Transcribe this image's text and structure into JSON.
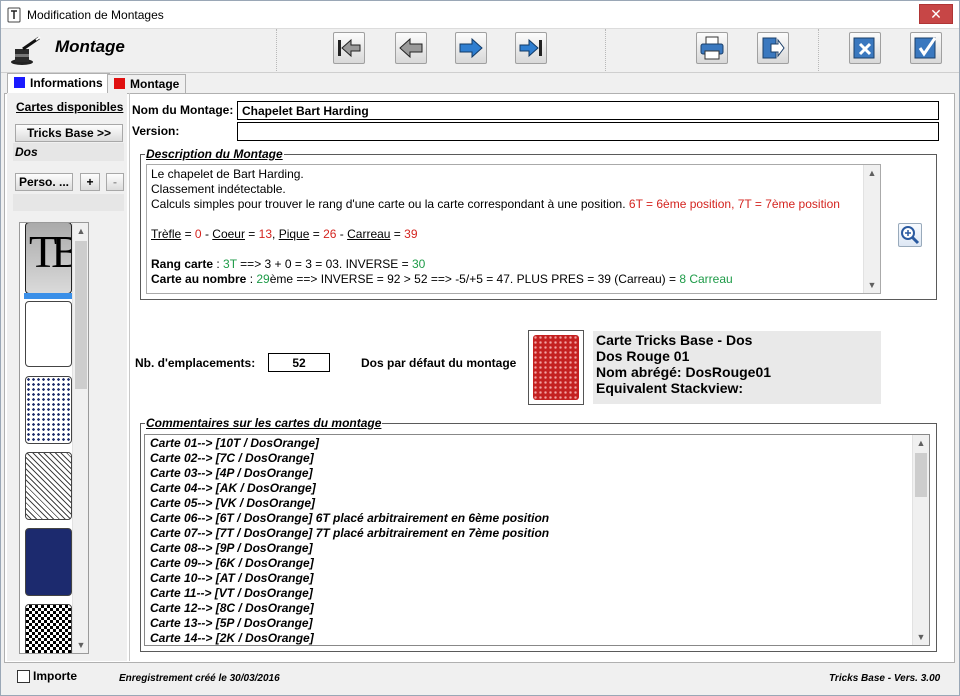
{
  "window": {
    "title": "Modification de Montages",
    "close_glyph": "✕"
  },
  "toolbar": {
    "heading": "Montage",
    "buttons": [
      {
        "name": "first-record-button",
        "icon": "first-arrow-icon"
      },
      {
        "name": "previous-record-button",
        "icon": "left-arrow-icon"
      },
      {
        "name": "next-record-button",
        "icon": "right-arrow-icon"
      },
      {
        "name": "last-record-button",
        "icon": "last-arrow-icon"
      },
      {
        "name": "print-button",
        "icon": "printer-icon"
      },
      {
        "name": "export-button",
        "icon": "exit-arrow-icon"
      },
      {
        "name": "cancel-button",
        "icon": "cancel-x-icon"
      },
      {
        "name": "validate-button",
        "icon": "checkmark-icon"
      }
    ]
  },
  "tabs": [
    {
      "label": "Informations",
      "color": "#1a1aff",
      "active": true
    },
    {
      "label": "Montage",
      "color": "#e01010",
      "active": false
    }
  ],
  "sidebar": {
    "cards_label": "Cartes disponibles",
    "tricks_button": "Tricks Base >>",
    "dos_label": "Dos",
    "perso_button": "Perso. ...",
    "plus_button": "+",
    "minus_button": "-",
    "thumb_logo": "TB"
  },
  "form": {
    "name_label": "Nom du Montage:",
    "name_value": "Chapelet Bart Harding",
    "version_label": "Version:",
    "version_value": ""
  },
  "description": {
    "title": "Description du Montage",
    "line1": "Le chapelet de Bart Harding.",
    "line2": "Classement indétectable.",
    "line3_text": "Calculs simples pour trouver le rang d'une carte ou la carte correspondant à une position. ",
    "line3_red": "6T = 6ème position, 7T = 7ème position",
    "suits": {
      "trefle": "Trèfle",
      "trefle_eq": " = ",
      "trefle_val": "0",
      "sep1": " - ",
      "coeur": "Coeur",
      "coeur_eq": " = ",
      "coeur_val": "13",
      "sep2": ", ",
      "pique": "Pique",
      "pique_eq": " = ",
      "pique_val": "26",
      "sep3": " - ",
      "carreau": "Carreau",
      "carreau_eq": " = ",
      "carreau_val": "39"
    },
    "rang": {
      "label": "Rang carte",
      "colon": " : ",
      "val1": "3T",
      "mid": " ==> 3 + 0 = 3 = 03. INVERSE = ",
      "val2": "30"
    },
    "nombre": {
      "label": "Carte au nombre",
      "colon": " : ",
      "val1": "29",
      "mid": "ème ==> INVERSE = 92 > 52 ==> -5/+5 = 47. PLUS PRES = 39 (Carreau) = ",
      "val2": "8 Carreau"
    }
  },
  "emplacements": {
    "label": "Nb. d'emplacements:",
    "value": "52"
  },
  "dos_defaut_label": "Dos par défaut du montage",
  "card_info": {
    "line1": "Carte Tricks Base - Dos",
    "line2": "Dos Rouge 01",
    "line3": "Nom abrégé: DosRouge01",
    "line4": "Equivalent Stackview:"
  },
  "comments": {
    "title": "Commentaires sur les cartes du montage",
    "items": [
      "Carte 01--> [10T / DosOrange]",
      "Carte 02--> [7C / DosOrange]",
      "Carte 03--> [4P / DosOrange]",
      "Carte 04--> [AK / DosOrange]",
      "Carte 05--> [VK / DosOrange]",
      "Carte 06--> [6T / DosOrange] 6T placé arbitrairement en 6ème position",
      "Carte 07--> [7T / DosOrange] 7T placé arbitrairement en 7ème position",
      "Carte 08--> [9P / DosOrange]",
      "Carte 09--> [6K / DosOrange]",
      "Carte 10--> [AT / DosOrange]",
      "Carte 11--> [VT / DosOrange]",
      "Carte 12--> [8C / DosOrange]",
      "Carte 13--> [5P / DosOrange]",
      "Carte 14--> [2K / DosOrange]"
    ]
  },
  "status": {
    "importe_label": "Importe",
    "importe_checked": false,
    "created": "Enregistrement créé le 30/03/2016",
    "version": "Tricks Base - Vers. 3.00"
  }
}
